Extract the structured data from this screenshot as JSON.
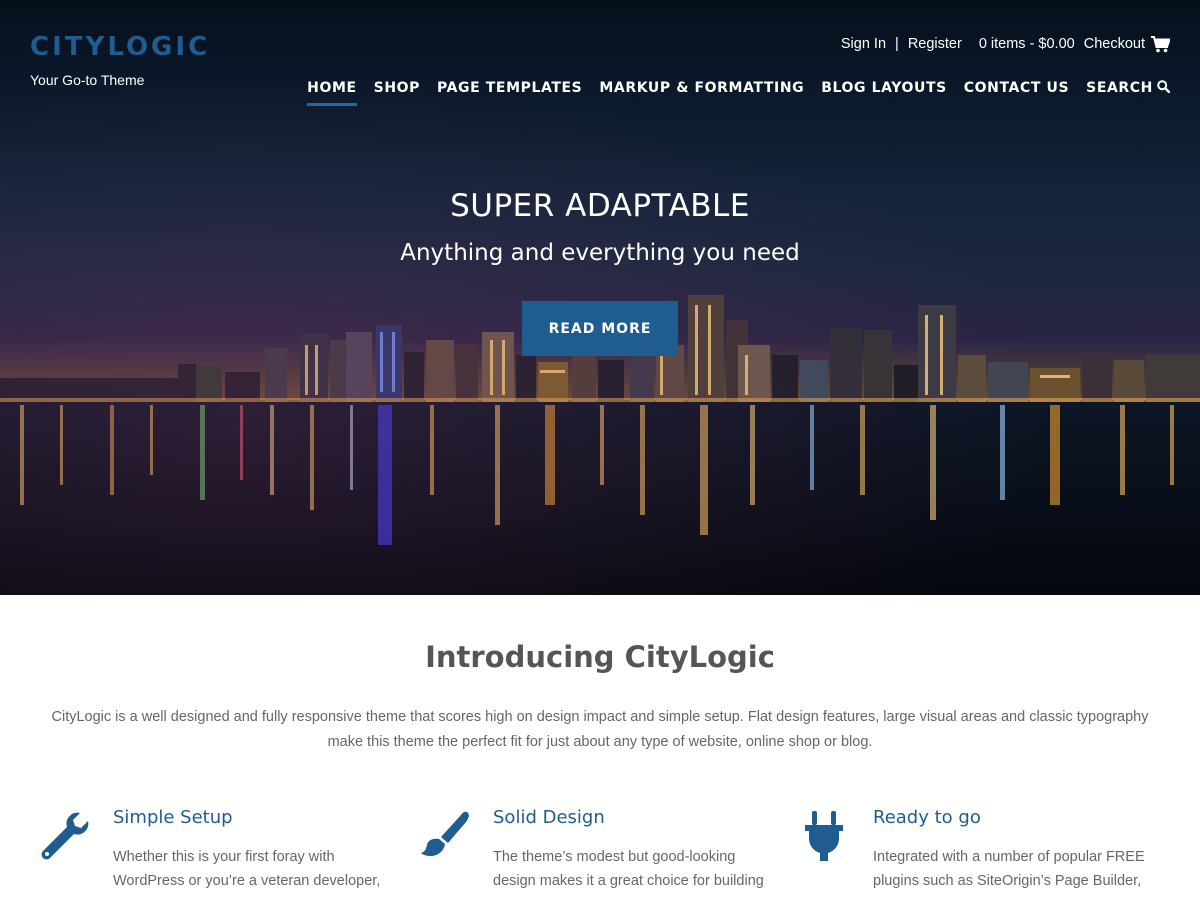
{
  "site": {
    "title": "CITYLOGIC",
    "tagline": "Your Go-to Theme"
  },
  "topbar": {
    "sign_in": "Sign In",
    "separator": "|",
    "register": "Register",
    "cart_summary": "0 items - $0.00",
    "checkout": "Checkout",
    "cart_icon": "shopping-cart-icon"
  },
  "nav": {
    "items": [
      {
        "label": "HOME",
        "active": true
      },
      {
        "label": "SHOP"
      },
      {
        "label": "PAGE TEMPLATES"
      },
      {
        "label": "MARKUP & FORMATTING"
      },
      {
        "label": "BLOG LAYOUTS"
      },
      {
        "label": "CONTACT US"
      },
      {
        "label": "SEARCH",
        "icon": "search-icon"
      }
    ]
  },
  "hero": {
    "title": "SUPER ADAPTABLE",
    "subtitle": "Anything and everything you need",
    "button": "READ MORE"
  },
  "intro": {
    "title": "Introducing CityLogic",
    "text": "CityLogic is a well designed and fully responsive theme that scores high on design impact and simple setup. Flat design features, large visual areas and classic typography make this theme the perfect fit for just about any type of website, online shop or blog."
  },
  "features": [
    {
      "icon": "wrench-icon",
      "title": "Simple Setup",
      "text": "Whether this is your first foray with WordPress or you’re a veteran developer,"
    },
    {
      "icon": "paintbrush-icon",
      "title": "Solid Design",
      "text": "The theme’s modest but good-looking design makes it a great choice for building"
    },
    {
      "icon": "plug-icon",
      "title": "Ready to go",
      "text": "Integrated with a number of popular FREE plugins such as SiteOrigin’s Page Builder,"
    }
  ],
  "colors": {
    "brand_blue": "#1f5c8f",
    "nav_active_underline": "#1f6aa5",
    "text_gray": "#666666"
  }
}
